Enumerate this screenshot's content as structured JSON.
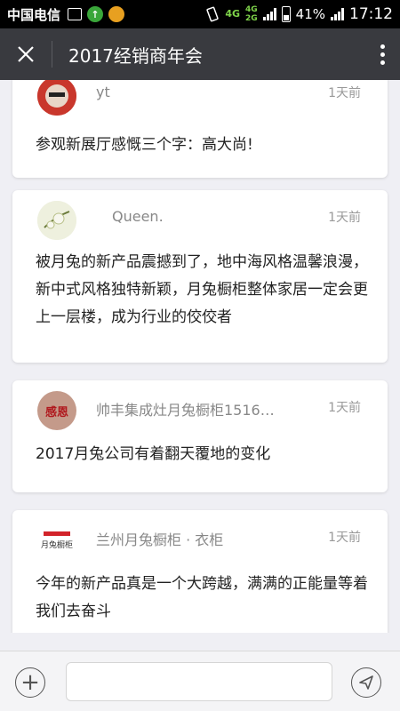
{
  "status_bar": {
    "carrier": "中国电信",
    "app_badge": "↑",
    "network": "4G",
    "network2": "4G",
    "network3": "2G",
    "battery": "41%",
    "time": "17:12"
  },
  "nav": {
    "title": "2017经销商年会"
  },
  "comments": [
    {
      "nickname": "yt",
      "time": "1天前",
      "text": "参观新展厅感慨三个字：高大尚!"
    },
    {
      "nickname": "Queen.",
      "time": "1天前",
      "text": "被月兔的新产品震撼到了，地中海风格温馨浪漫，新中式风格独特新颖，月兔橱柜整体家居一定会更上一层楼，成为行业的佼佼者"
    },
    {
      "nickname": "帅丰集成灶月兔橱柜1516…",
      "time": "1天前",
      "avatar_text": "感恩",
      "text": "2017月兔公司有着翻天覆地的变化"
    },
    {
      "nickname": "兰州月兔橱柜 · 衣柜",
      "time": "1天前",
      "avatar_text": "月兔橱柜",
      "text": "今年的新产品真是一个大跨越，满满的正能量等着我们去奋斗"
    }
  ],
  "composer": {
    "input_value": ""
  },
  "colors": {
    "navbar": "#393a3f",
    "background": "#efeff4",
    "network_green": "#7fd44a"
  }
}
